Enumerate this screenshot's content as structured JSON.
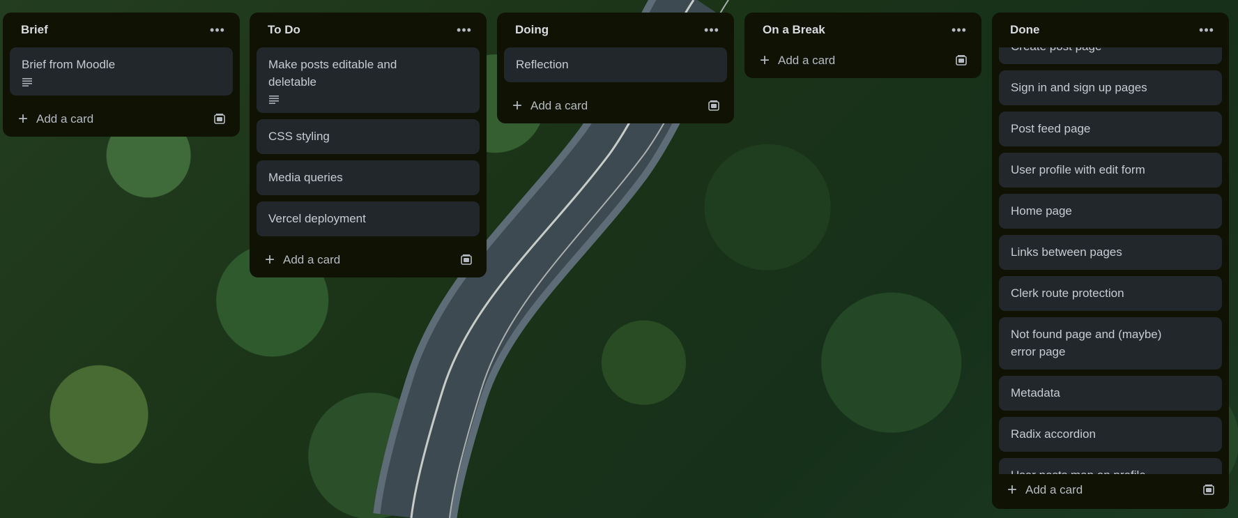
{
  "board": {
    "lists": [
      {
        "title": "Brief",
        "cards": [
          {
            "title": "Brief from Moodle",
            "has_description": true
          }
        ],
        "add_label": "Add a card"
      },
      {
        "title": "To Do",
        "cards": [
          {
            "title": "Make posts editable and deletable",
            "has_description": true
          },
          {
            "title": "CSS styling",
            "has_description": false
          },
          {
            "title": "Media queries",
            "has_description": false
          },
          {
            "title": "Vercel deployment",
            "has_description": false
          }
        ],
        "add_label": "Add a card"
      },
      {
        "title": "Doing",
        "cards": [
          {
            "title": "Reflection",
            "has_description": false
          }
        ],
        "add_label": "Add a card"
      },
      {
        "title": "On a Break",
        "cards": [],
        "add_label": "Add a card"
      },
      {
        "title": "Done",
        "cards": [
          {
            "title": "Create post page"
          },
          {
            "title": "Sign in and sign up pages"
          },
          {
            "title": "Post feed page"
          },
          {
            "title": "User profile with edit form"
          },
          {
            "title": "Home page"
          },
          {
            "title": "Links between pages"
          },
          {
            "title": "Clerk route protection"
          },
          {
            "title": "Not found page and (maybe) error page"
          },
          {
            "title": "Metadata"
          },
          {
            "title": "Radix accordion"
          },
          {
            "title": "User posts map on profile"
          }
        ],
        "add_label": "Add a card"
      }
    ]
  },
  "icons": {
    "more": "more-horizontal-icon",
    "plus": "plus-icon",
    "template": "card-template-icon",
    "description": "description-icon"
  },
  "colors": {
    "list_bg": "#101204",
    "card_bg": "#22272b",
    "text": "#c8ccd2"
  }
}
